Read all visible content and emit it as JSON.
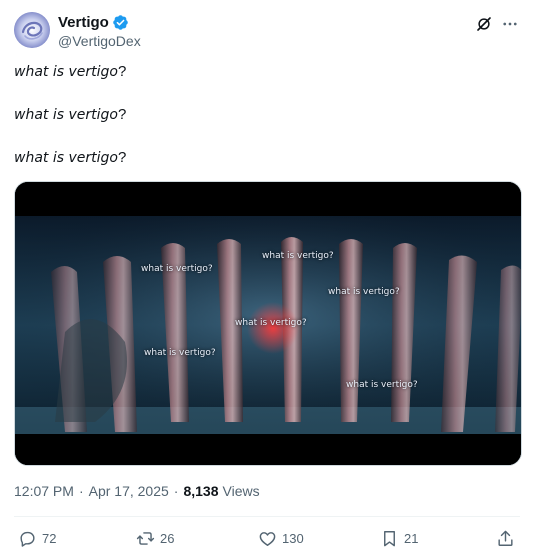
{
  "author": {
    "display_name": "Vertigo",
    "handle": "@VertigoDex",
    "verified": true,
    "verified_color": "#1d9bf0"
  },
  "header_icons": [
    "grok-icon",
    "more-options-icon"
  ],
  "post": {
    "lines": [
      {
        "italic": "what is vertigo",
        "plain": "?"
      },
      {
        "italic": "what is vertigo",
        "plain": "?"
      },
      {
        "italic": "what is vertigo",
        "plain": "?"
      }
    ]
  },
  "media": {
    "type": "video-still",
    "captions": [
      "what is vertigo?",
      "what is vertigo?",
      "what is vertigo?",
      "what is vertigo?",
      "what is vertigo?",
      "what is vertigo?"
    ]
  },
  "meta": {
    "time": "12:07 PM",
    "separator": "·",
    "date": "Apr 17, 2025",
    "views_count": "8,138",
    "views_label": "Views"
  },
  "actions": {
    "replies": "72",
    "reposts": "26",
    "likes": "130",
    "bookmarks": "21"
  },
  "colors": {
    "text": "#0f1419",
    "secondary": "#536471",
    "divider": "#eff3f4"
  }
}
